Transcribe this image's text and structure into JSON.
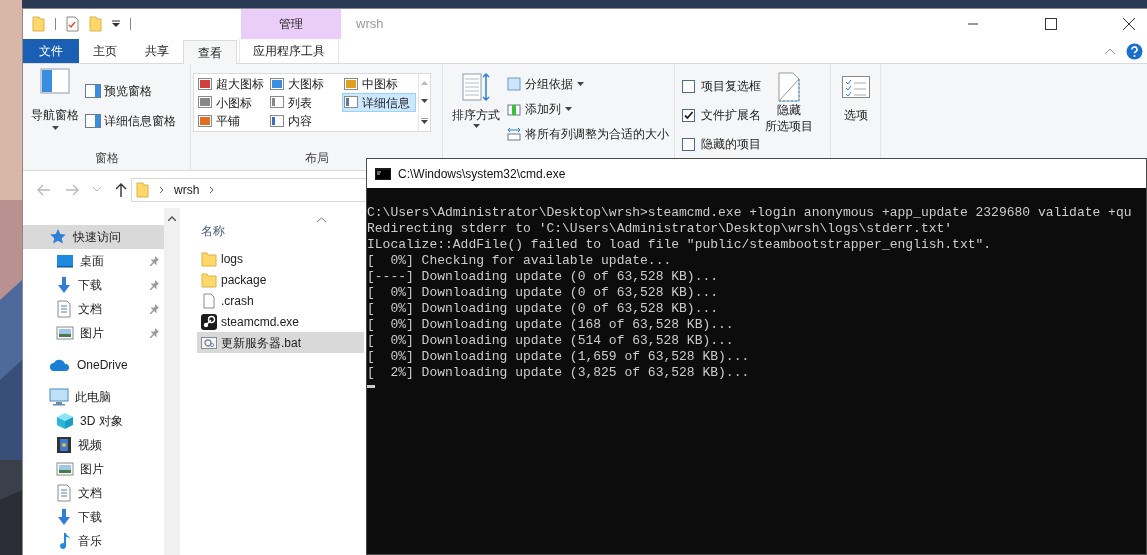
{
  "explorer": {
    "title": "wrsh",
    "context_tab": "管理",
    "tabs": [
      {
        "label": "文件",
        "kind": "file",
        "selected": false
      },
      {
        "label": "主页",
        "kind": "tab",
        "selected": false
      },
      {
        "label": "共享",
        "kind": "tab",
        "selected": false
      },
      {
        "label": "查看",
        "kind": "tab",
        "selected": true
      },
      {
        "label": "应用程序工具",
        "kind": "context",
        "selected": false
      }
    ],
    "ribbon": {
      "panes": {
        "nav_pane": "导航窗格",
        "preview_pane": "预览窗格",
        "details_pane": "详细信息窗格",
        "group_label": "窗格"
      },
      "layout": {
        "options": [
          {
            "label": "超大图标",
            "kind": "xl",
            "selected": false
          },
          {
            "label": "大图标",
            "kind": "lg",
            "selected": false
          },
          {
            "label": "中图标",
            "kind": "md",
            "selected": false
          },
          {
            "label": "小图标",
            "kind": "sm",
            "selected": false
          },
          {
            "label": "列表",
            "kind": "list",
            "selected": false
          },
          {
            "label": "详细信息",
            "kind": "details",
            "selected": true
          },
          {
            "label": "平铺",
            "kind": "tiles",
            "selected": false
          },
          {
            "label": "内容",
            "kind": "content",
            "selected": false
          }
        ],
        "group_label": "布局"
      },
      "current_view": {
        "sort": "排序方式",
        "group_by": "分组依据",
        "add_column": "添加列",
        "size_columns": "将所有列调整为合适的大小"
      },
      "show_hide": {
        "checkboxes": [
          {
            "label": "项目复选框",
            "checked": false
          },
          {
            "label": "文件扩展名",
            "checked": true
          },
          {
            "label": "隐藏的项目",
            "checked": false
          }
        ],
        "hide_selected": [
          "隐藏",
          "所选项目"
        ]
      },
      "options": "选项"
    },
    "address": {
      "path": [
        "wrsh"
      ]
    },
    "nav": [
      {
        "label": "快速访问",
        "kind": "star",
        "selected": true,
        "children": [
          {
            "label": "桌面",
            "kind": "desktop",
            "pinned": true
          },
          {
            "label": "下载",
            "kind": "download",
            "pinned": true
          },
          {
            "label": "文档",
            "kind": "document",
            "pinned": true
          },
          {
            "label": "图片",
            "kind": "picture",
            "pinned": true
          }
        ]
      },
      {
        "label": "OneDrive",
        "kind": "cloud",
        "selected": false
      },
      {
        "label": "此电脑",
        "kind": "pc",
        "selected": false,
        "children": [
          {
            "label": "3D 对象",
            "kind": "cube",
            "pinned": false
          },
          {
            "label": "视频",
            "kind": "video",
            "pinned": false
          },
          {
            "label": "图片",
            "kind": "picture",
            "pinned": false
          },
          {
            "label": "文档",
            "kind": "document",
            "pinned": false
          },
          {
            "label": "下载",
            "kind": "download",
            "pinned": false
          },
          {
            "label": "音乐",
            "kind": "music",
            "pinned": false
          }
        ]
      }
    ],
    "column_header": "名称",
    "files": [
      {
        "name": "logs",
        "kind": "folder",
        "selected": false
      },
      {
        "name": "package",
        "kind": "folder",
        "selected": false
      },
      {
        "name": ".crash",
        "kind": "file",
        "selected": false
      },
      {
        "name": "steamcmd.exe",
        "kind": "steam",
        "selected": false
      },
      {
        "name": "更新服务器.bat",
        "kind": "bat",
        "selected": true
      }
    ]
  },
  "cmd": {
    "title": "C:\\Windows\\system32\\cmd.exe",
    "lines": [
      "C:\\Users\\Administrator\\Desktop\\wrsh>steamcmd.exe +login anonymous +app_update 2329680 validate +qu",
      "Redirecting stderr to 'C:\\Users\\Administrator\\Desktop\\wrsh\\logs\\stderr.txt'",
      "ILocalize::AddFile() failed to load file \"public/steambootstrapper_english.txt\".",
      "[  0%] Checking for available update...",
      "[----] Downloading update (0 of 63,528 KB)...",
      "[  0%] Downloading update (0 of 63,528 KB)...",
      "[  0%] Downloading update (0 of 63,528 KB)...",
      "[  0%] Downloading update (168 of 63,528 KB)...",
      "[  0%] Downloading update (514 of 63,528 KB)...",
      "[  0%] Downloading update (1,659 of 63,528 KB)...",
      "[  2%] Downloading update (3,825 of 63,528 KB)..."
    ]
  }
}
